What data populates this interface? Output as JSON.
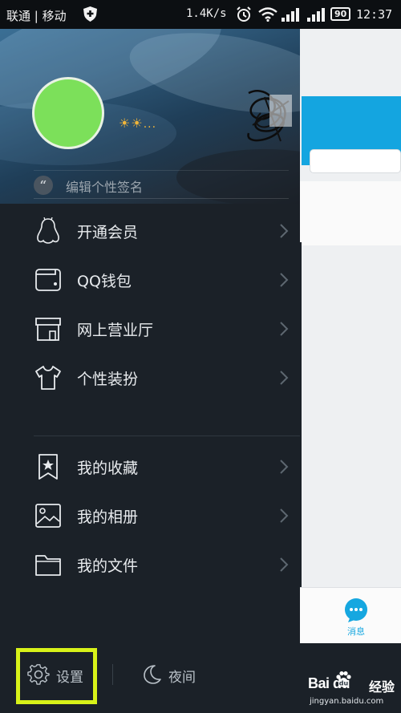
{
  "status_bar": {
    "carrier": "联通 | 移动",
    "net_speed": "1.4K/s",
    "battery": "90",
    "time": "12:37"
  },
  "profile": {
    "level_icons": "☀☀",
    "level_more": "...",
    "signature_placeholder": "编辑个性签名"
  },
  "menu": [
    {
      "label": "开通会员",
      "icon": "penguin-icon"
    },
    {
      "label": "QQ钱包",
      "icon": "wallet-icon"
    },
    {
      "label": "网上营业厅",
      "icon": "store-icon"
    },
    {
      "label": "个性装扮",
      "icon": "tshirt-icon"
    },
    {
      "label": "我的收藏",
      "icon": "bookmark-star-icon"
    },
    {
      "label": "我的相册",
      "icon": "photo-icon"
    },
    {
      "label": "我的文件",
      "icon": "folder-icon"
    }
  ],
  "bottom": {
    "settings_label": "设置",
    "night_label": "夜间"
  },
  "main_peek": {
    "tab_messages_label": "消息"
  },
  "watermark": {
    "brand": "Bai du",
    "jingyan": "经验",
    "url": "jingyan.baidu.com"
  },
  "colors": {
    "drawer_bg": "#1b2128",
    "avatar": "#7ce05a",
    "highlight_box": "#d8f219",
    "accent_blue": "#14a5e0"
  }
}
